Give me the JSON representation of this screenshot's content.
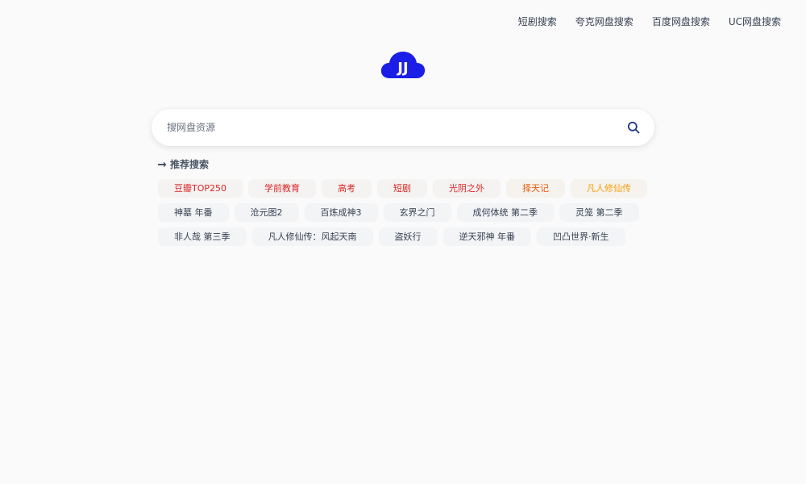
{
  "nav": {
    "links": [
      "短剧搜索",
      "夸克网盘搜索",
      "百度网盘搜索",
      "UC网盘搜索"
    ]
  },
  "logo": {
    "text": "JJ",
    "color": "#1a1ee6"
  },
  "search": {
    "placeholder": "搜网盘资源",
    "value": "",
    "icon": "search-icon",
    "icon_color": "#1e3a8a"
  },
  "recommend": {
    "title": "推荐搜索",
    "icon": "arrow-right-icon",
    "rows": [
      [
        {
          "label": "豆瓣TOP250",
          "color": "#dc2626"
        },
        {
          "label": "学前教育",
          "color": "#dc2626"
        },
        {
          "label": "高考",
          "color": "#dc2626"
        },
        {
          "label": "短剧",
          "color": "#dc2626"
        },
        {
          "label": "光阴之外",
          "color": "#dc2626"
        },
        {
          "label": "择天记",
          "color": "#ea580c"
        },
        {
          "label": "凡人修仙传",
          "color": "#f59e0b"
        }
      ],
      [
        {
          "label": "神墓 年番",
          "color": "#374151"
        },
        {
          "label": "沧元图2",
          "color": "#374151"
        },
        {
          "label": "百炼成神3",
          "color": "#374151"
        },
        {
          "label": "玄界之门",
          "color": "#374151"
        },
        {
          "label": "成何体统 第二季",
          "color": "#374151"
        },
        {
          "label": "灵笼 第二季",
          "color": "#374151"
        }
      ],
      [
        {
          "label": "非人哉 第三季",
          "color": "#374151"
        },
        {
          "label": "凡人修仙传：风起天南",
          "color": "#374151"
        },
        {
          "label": "盗妖行",
          "color": "#374151"
        },
        {
          "label": "逆天邪神 年番",
          "color": "#374151"
        },
        {
          "label": "凹凸世界·新生",
          "color": "#374151"
        }
      ]
    ]
  }
}
